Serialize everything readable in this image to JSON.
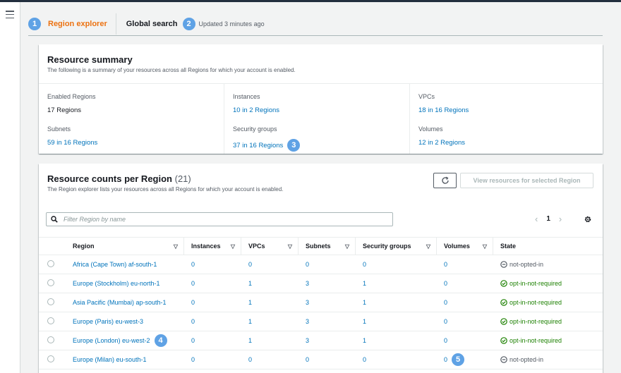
{
  "tabs": {
    "region_explorer": {
      "badge": "1",
      "label": "Region explorer"
    },
    "global_search": {
      "label": "Global search",
      "badge": "2"
    },
    "updated": "Updated 3 minutes ago"
  },
  "summary": {
    "title": "Resource summary",
    "description": "The following is a summary of your resources across all Regions for which your account is enabled.",
    "items": [
      {
        "label": "Enabled Regions",
        "value": "17 Regions"
      },
      {
        "label": "Instances",
        "value": "10 in 2 Regions"
      },
      {
        "label": "VPCs",
        "value": "18 in 16 Regions"
      },
      {
        "label": "Subnets",
        "value": "59 in 16 Regions"
      },
      {
        "label": "Security groups",
        "value": "37 in 16 Regions",
        "badge": "3"
      },
      {
        "label": "Volumes",
        "value": "12 in 2 Regions"
      }
    ]
  },
  "counts": {
    "title": "Resource counts per Region",
    "count": "(21)",
    "description": "The Region explorer lists your resources across all Regions for which your account is enabled.",
    "view_button": "View resources for selected Region",
    "filter_placeholder": "Filter Region by name",
    "page": "1",
    "columns": [
      "Region",
      "Instances",
      "VPCs",
      "Subnets",
      "Security groups",
      "Volumes",
      "State"
    ],
    "rows": [
      {
        "region": "Africa (Cape Town) af-south-1",
        "instances": "0",
        "vpcs": "0",
        "subnets": "0",
        "sgs": "0",
        "volumes": "0",
        "state": "not-opted-in"
      },
      {
        "region": "Europe (Stockholm) eu-north-1",
        "instances": "0",
        "vpcs": "1",
        "subnets": "3",
        "sgs": "1",
        "volumes": "0",
        "state": "opt-in-not-required"
      },
      {
        "region": "Asia Pacific (Mumbai) ap-south-1",
        "instances": "0",
        "vpcs": "1",
        "subnets": "3",
        "sgs": "1",
        "volumes": "0",
        "state": "opt-in-not-required"
      },
      {
        "region": "Europe (Paris) eu-west-3",
        "instances": "0",
        "vpcs": "1",
        "subnets": "3",
        "sgs": "1",
        "volumes": "0",
        "state": "opt-in-not-required"
      },
      {
        "region": "Europe (London) eu-west-2",
        "region_badge": "4",
        "instances": "0",
        "vpcs": "1",
        "subnets": "3",
        "sgs": "1",
        "volumes": "0",
        "state": "opt-in-not-required"
      },
      {
        "region": "Europe (Milan) eu-south-1",
        "instances": "0",
        "vpcs": "0",
        "subnets": "0",
        "sgs": "0",
        "volumes": "0",
        "volumes_badge": "5",
        "state": "not-opted-in"
      }
    ]
  },
  "colors": {
    "accent": "#ec7211",
    "link": "#0073bb",
    "success": "#1d8102",
    "badge": "#5fa2e5"
  }
}
